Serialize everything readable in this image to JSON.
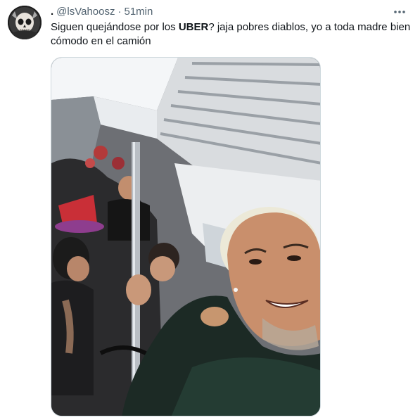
{
  "tweet": {
    "display_name": ".",
    "handle": "@lsVahoosz",
    "separator": "·",
    "time": "51min",
    "text_before": "Siguen quejándose por los ",
    "text_bold": "UBER",
    "text_after": "? jaja pobres diablos, yo a toda madre bien cómodo en el camión",
    "avatar_icon": "skull-avatar-icon",
    "more_icon": "more-horizontal-icon",
    "media_description_icon": "photo-icon"
  },
  "colors": {
    "text_primary": "#0f1419",
    "text_secondary": "#536471",
    "border": "#cfd9de"
  }
}
